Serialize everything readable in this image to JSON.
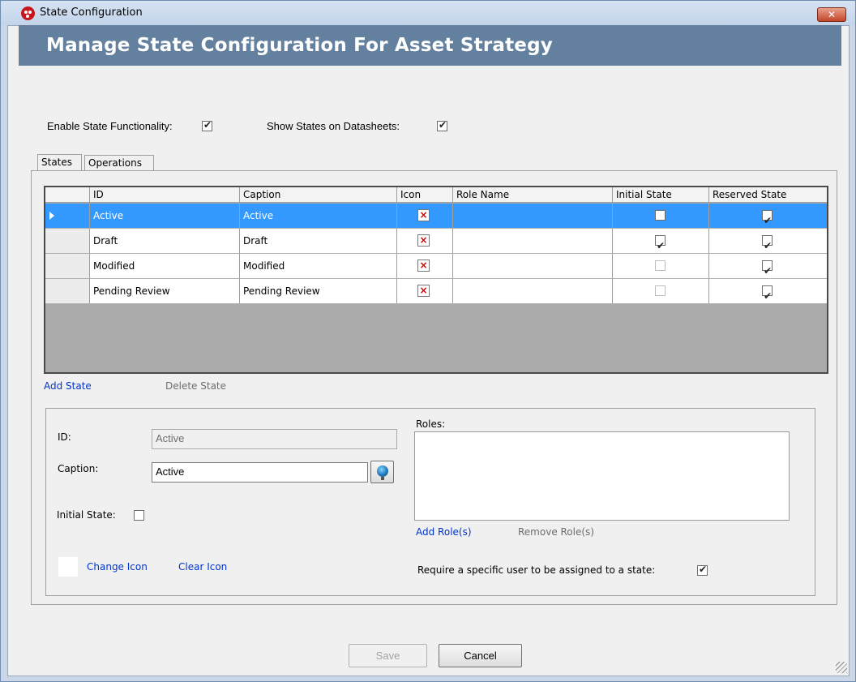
{
  "window": {
    "title": "State Configuration",
    "close_glyph": "✕"
  },
  "banner": {
    "title": "Manage State Configuration For Asset Strategy"
  },
  "options": {
    "enable_state_label": "Enable State Functionality:",
    "enable_state_checked": true,
    "show_states_label": "Show States on Datasheets:",
    "show_states_checked": true
  },
  "tabs": [
    {
      "label": "States",
      "active": true
    },
    {
      "label": "Operations",
      "active": false
    }
  ],
  "grid": {
    "columns": [
      "ID",
      "Caption",
      "Icon",
      "Role Name",
      "Initial State",
      "Reserved State"
    ],
    "rows": [
      {
        "id": "Active",
        "caption": "Active",
        "icon": "missing-image-icon",
        "role_name": "",
        "initial_state": false,
        "reserved_state": true,
        "selected": true
      },
      {
        "id": "Draft",
        "caption": "Draft",
        "icon": "missing-image-icon",
        "role_name": "",
        "initial_state": true,
        "reserved_state": true,
        "selected": false
      },
      {
        "id": "Modified",
        "caption": "Modified",
        "icon": "missing-image-icon",
        "role_name": "",
        "initial_state": false,
        "reserved_state": true,
        "selected": false
      },
      {
        "id": "Pending Review",
        "caption": "Pending Review",
        "icon": "missing-image-icon",
        "role_name": "",
        "initial_state": false,
        "reserved_state": true,
        "selected": false
      }
    ],
    "selection_color": "#3399ff"
  },
  "grid_actions": {
    "add_state": "Add State",
    "delete_state": "Delete State"
  },
  "details": {
    "id_label": "ID:",
    "id_value": "Active",
    "caption_label": "Caption:",
    "caption_value": "Active",
    "initial_state_label": "Initial State:",
    "initial_state_checked": false,
    "roles_label": "Roles:",
    "add_roles": "Add Role(s)",
    "remove_roles": "Remove Role(s)",
    "change_icon": "Change Icon",
    "clear_icon": "Clear Icon",
    "require_user_label": "Require a specific user to be assigned to a state:",
    "require_user_checked": true
  },
  "footer": {
    "save_label": "Save",
    "cancel_label": "Cancel"
  },
  "colors": {
    "banner": "#63809f",
    "link": "#0033cc",
    "titlebar": "#c9d7e8"
  }
}
